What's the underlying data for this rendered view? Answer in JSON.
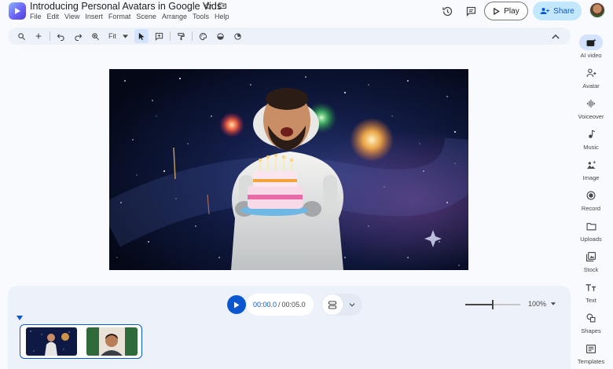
{
  "app": {
    "title": "Introducing Personal Avatars in Google Vids",
    "menu": [
      "File",
      "Edit",
      "View",
      "Insert",
      "Format",
      "Scene",
      "Arrange",
      "Tools",
      "Help"
    ]
  },
  "header": {
    "play_label": "Play",
    "share_label": "Share",
    "accent": "#0b57d0",
    "share_bg": "#c2e7ff"
  },
  "toolbar": {
    "zoom_fit_label": "Fit",
    "icons": [
      "search-icon",
      "add-icon",
      "undo-icon",
      "redo-icon",
      "zoom-icon",
      "select-icon",
      "comment-icon",
      "paint-format-icon",
      "palette-icon",
      "fill-icon",
      "brush-icon"
    ]
  },
  "right_panel": {
    "items": [
      {
        "label": "AI video",
        "icon": "ai-video-icon",
        "active": true
      },
      {
        "label": "Avatar",
        "icon": "avatar-icon"
      },
      {
        "label": "Voiceover",
        "icon": "voiceover-icon"
      },
      {
        "label": "Music",
        "icon": "music-icon"
      },
      {
        "label": "Image",
        "icon": "image-icon"
      },
      {
        "label": "Record",
        "icon": "record-icon"
      },
      {
        "label": "Uploads",
        "icon": "uploads-icon"
      },
      {
        "label": "Stock",
        "icon": "stock-icon"
      },
      {
        "label": "Text",
        "icon": "text-icon"
      },
      {
        "label": "Shapes",
        "icon": "shapes-icon"
      },
      {
        "label": "Templates",
        "icon": "templates-icon"
      }
    ]
  },
  "timeline": {
    "current_time": "00:00.0",
    "separator": "/",
    "duration": "00:05.0",
    "zoom_label": "100%",
    "zoom_level": 0.5
  }
}
